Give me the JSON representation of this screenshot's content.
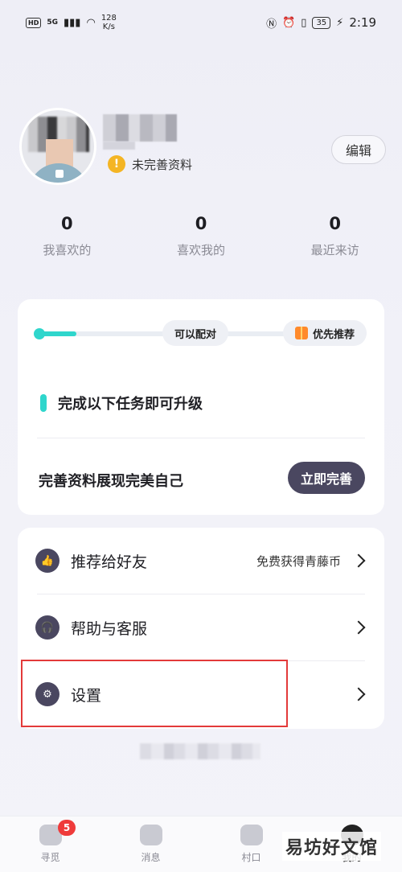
{
  "status_bar": {
    "hd": "HD",
    "net": "5G",
    "speed_top": "128",
    "speed_bottom": "K/s",
    "battery": "35",
    "time": "2:19"
  },
  "profile": {
    "incomplete_label": "未完善资料",
    "edit_label": "编辑"
  },
  "stats": [
    {
      "value": "0",
      "label": "我喜欢的"
    },
    {
      "value": "0",
      "label": "喜欢我的"
    },
    {
      "value": "0",
      "label": "最近来访"
    }
  ],
  "progress_card": {
    "progress_fraction": 0.12,
    "match_label": "可以配对",
    "recommend_label": "优先推荐",
    "task_title": "完成以下任务即可升级",
    "complete_text": "完善资料展现完美自己",
    "complete_button": "立即完善"
  },
  "menu": {
    "items": [
      {
        "label": "推荐给好友",
        "extra": "免费获得青藤币",
        "icon": "thumbs-up-icon"
      },
      {
        "label": "帮助与客服",
        "extra": "",
        "icon": "headset-icon"
      },
      {
        "label": "设置",
        "extra": "",
        "icon": "gear-icon"
      }
    ]
  },
  "tabs": [
    {
      "label": "寻觅",
      "badge": "5"
    },
    {
      "label": "消息"
    },
    {
      "label": "村口"
    },
    {
      "label": "我的"
    }
  ],
  "watermark": "易坊好文馆",
  "colors": {
    "accent": "#2fd6cc",
    "primary_dark": "#4a4760",
    "badge_red": "#ef3b3b",
    "warning": "#f4b524",
    "highlight_red": "#e33a3a"
  }
}
